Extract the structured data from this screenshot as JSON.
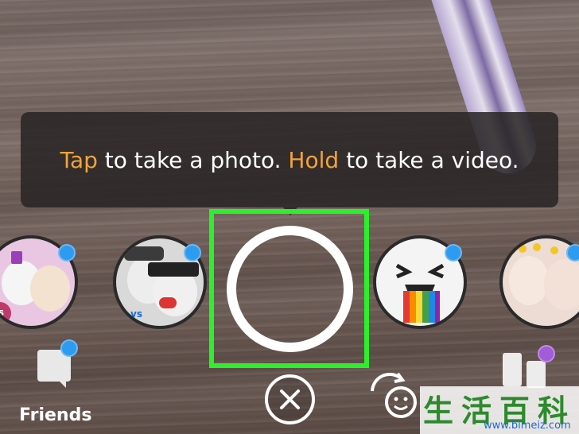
{
  "tooltip": {
    "word_tap": "Tap",
    "text_middle": " to take a photo. ",
    "word_hold": "Hold",
    "text_end": " to take a video."
  },
  "bottom_bar": {
    "friends_label": "Friends"
  },
  "lenses": [
    {
      "name": "lens-cat-dog-vs",
      "badge": "vs"
    },
    {
      "name": "lens-glasses-vs",
      "badge": "vs"
    },
    {
      "name": "lens-rainbow-face",
      "badge": ""
    },
    {
      "name": "lens-flower-crown",
      "badge": ""
    }
  ],
  "watermark": {
    "chars": "生活百科",
    "url": "www.bimeiz.com"
  },
  "colors": {
    "highlight_text": "#f2a33a",
    "highlight_box": "#2cf02c",
    "notification_dot": "#2d9bf0",
    "discover_dot": "#a15cd7"
  },
  "icons": {
    "close": "close-icon",
    "face_swap": "face-swap-icon",
    "friends": "chat-bubble-icon",
    "discover": "discover-icon"
  }
}
